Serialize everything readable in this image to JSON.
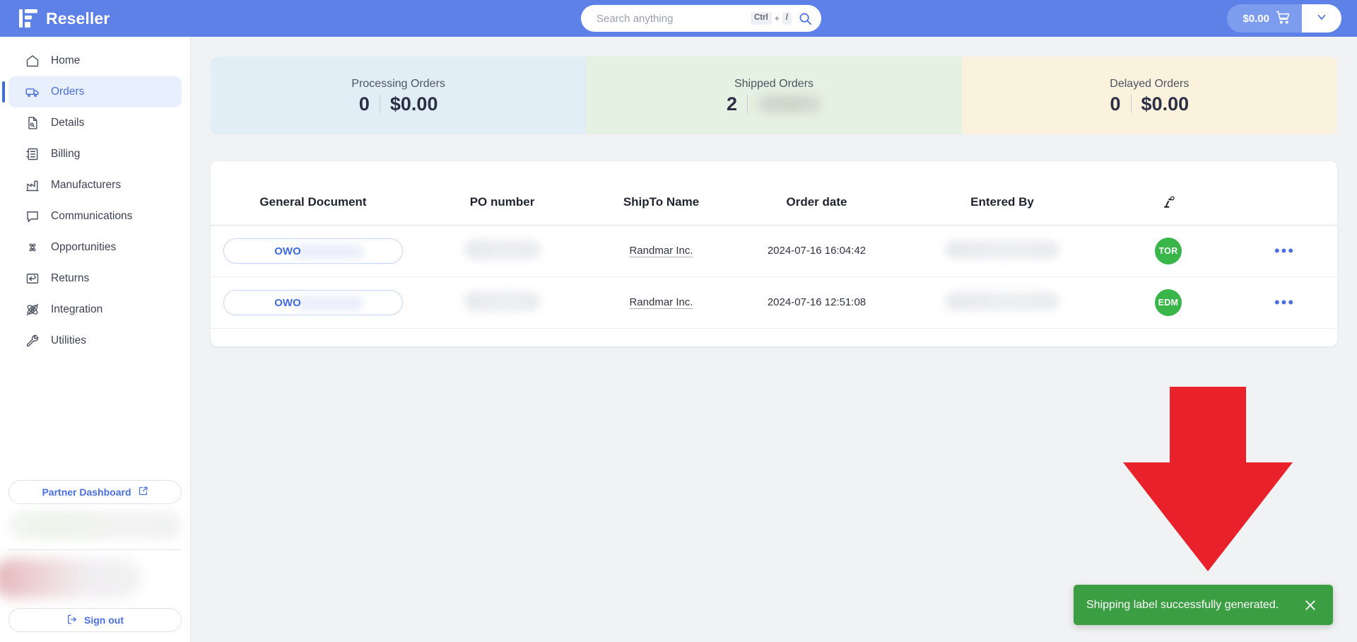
{
  "topbar": {
    "brand_name": "Reseller",
    "brand_logo_icon": "reseller-logo-icon",
    "search": {
      "placeholder": "Search anything",
      "value": "",
      "kbd_ctrl": "Ctrl",
      "kbd_plus": "+",
      "kbd_slash": "/",
      "search_icon": "search-icon"
    },
    "cart": {
      "amount": "$0.00",
      "cart_icon": "shopping-cart-icon",
      "chevron_icon": "chevron-down-icon"
    }
  },
  "sidebar": {
    "items": [
      {
        "label": "Home",
        "icon": "home-icon",
        "active": false
      },
      {
        "label": "Orders",
        "icon": "truck-icon",
        "active": true
      },
      {
        "label": "Details",
        "icon": "document-icon",
        "active": false
      },
      {
        "label": "Billing",
        "icon": "billing-icon",
        "active": false
      },
      {
        "label": "Manufacturers",
        "icon": "factory-icon",
        "active": false
      },
      {
        "label": "Communications",
        "icon": "chat-icon",
        "active": false
      },
      {
        "label": "Opportunities",
        "icon": "opportunities-icon",
        "active": false
      },
      {
        "label": "Returns",
        "icon": "return-icon",
        "active": false
      },
      {
        "label": "Integration",
        "icon": "integration-icon",
        "active": false
      },
      {
        "label": "Utilities",
        "icon": "wrench-icon",
        "active": false
      }
    ],
    "partner_dashboard": {
      "label": "Partner Dashboard",
      "icon": "external-link-icon"
    },
    "sign_out": {
      "label": "Sign out",
      "icon": "sign-out-icon"
    }
  },
  "stats": [
    {
      "title": "Processing Orders",
      "count": "0",
      "amount": "$0.00",
      "amount_masked": false,
      "tone": "blue"
    },
    {
      "title": "Shipped Orders",
      "count": "2",
      "amount": "",
      "amount_masked": true,
      "tone": "green"
    },
    {
      "title": "Delayed Orders",
      "count": "0",
      "amount": "$0.00",
      "amount_masked": false,
      "tone": "yellow"
    }
  ],
  "orders_table": {
    "columns": [
      "General Document",
      "PO number",
      "ShipTo Name",
      "Order date",
      "Entered By",
      "",
      ""
    ],
    "actions_header_icon": "robot-arm-icon",
    "rows": [
      {
        "general_document": "OWO",
        "general_document_masked": true,
        "po_number": "",
        "po_number_masked": true,
        "shipto_name": "Randmar Inc.",
        "order_date": "2024-07-16 16:04:42",
        "entered_by": "",
        "entered_by_masked": true,
        "avatar_initials": "TOR",
        "avatar_color": "#39b54a",
        "row_menu_icon": "ellipsis-icon"
      },
      {
        "general_document": "OWO",
        "general_document_masked": true,
        "po_number": "",
        "po_number_masked": true,
        "shipto_name": "Randmar Inc.",
        "order_date": "2024-07-16 12:51:08",
        "entered_by": "",
        "entered_by_masked": true,
        "avatar_initials": "EDM",
        "avatar_color": "#39b54a",
        "row_menu_icon": "ellipsis-icon"
      }
    ]
  },
  "annotation": {
    "arrow_icon": "down-arrow-annotation-icon",
    "arrow_color": "#e8212b"
  },
  "toast": {
    "message": "Shipping label successfully generated.",
    "close_icon": "close-icon",
    "background": "#3b9e42"
  },
  "colors": {
    "brand_blue": "#5e81e8",
    "accent_blue": "#4a6fe0",
    "success_green": "#39b54a",
    "page_bg": "#f1f2f4"
  }
}
